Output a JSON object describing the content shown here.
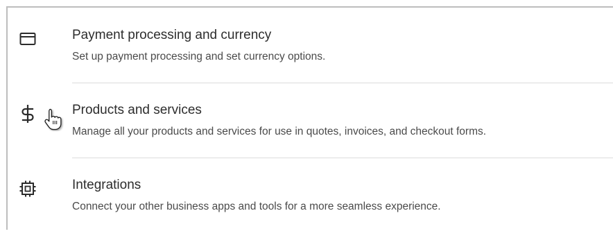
{
  "settings": {
    "items": [
      {
        "icon": "credit-card-icon",
        "title": "Payment processing and currency",
        "description": "Set up payment processing and set currency options."
      },
      {
        "icon": "dollar-sign-icon",
        "title": "Products and services",
        "description": "Manage all your products and services for use in quotes, invoices, and checkout forms."
      },
      {
        "icon": "chip-icon",
        "title": "Integrations",
        "description": "Connect your other business apps and tools for a more seamless experience."
      }
    ]
  },
  "colors": {
    "text": "#2d2d2d",
    "muted": "#4a4a4a",
    "divider": "#dcdcdc"
  }
}
